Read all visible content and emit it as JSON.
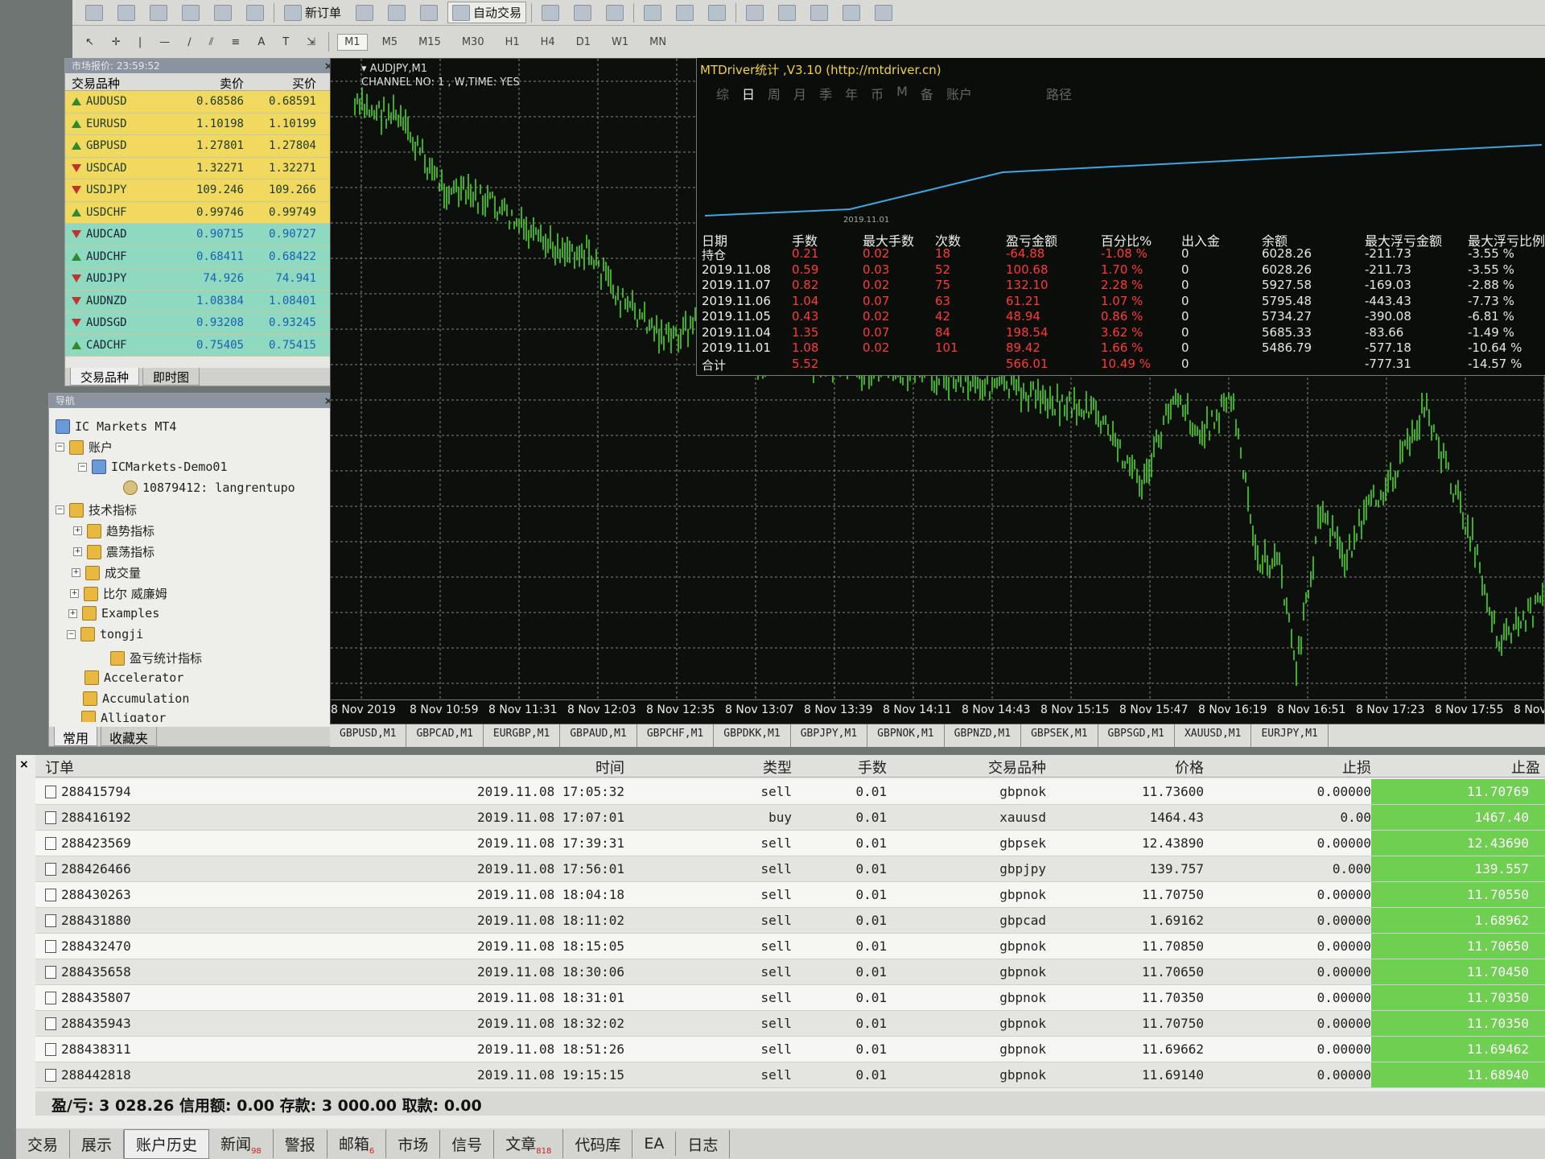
{
  "toolbar": {
    "new_order": "新订单",
    "auto_trading": "自动交易",
    "timeframes": [
      "M1",
      "M5",
      "M15",
      "M30",
      "H1",
      "H4",
      "D1",
      "W1",
      "MN"
    ]
  },
  "market_watch": {
    "title": "市场报价: 23:59:52",
    "col_symbol": "交易品种",
    "col_bid": "卖价",
    "col_ask": "买价",
    "rows": [
      {
        "symbol": "AUDUSD",
        "bid": "0.68586",
        "ask": "0.68591",
        "dir": "up"
      },
      {
        "symbol": "EURUSD",
        "bid": "1.10198",
        "ask": "1.10199",
        "dir": "up"
      },
      {
        "symbol": "GBPUSD",
        "bid": "1.27801",
        "ask": "1.27804",
        "dir": "up"
      },
      {
        "symbol": "USDCAD",
        "bid": "1.32271",
        "ask": "1.32271",
        "dir": "dn"
      },
      {
        "symbol": "USDJPY",
        "bid": "109.246",
        "ask": "109.266",
        "dir": "dn"
      },
      {
        "symbol": "USDCHF",
        "bid": "0.99746",
        "ask": "0.99749",
        "dir": "up"
      },
      {
        "symbol": "AUDCAD",
        "bid": "0.90715",
        "ask": "0.90727",
        "dir": "dn"
      },
      {
        "symbol": "AUDCHF",
        "bid": "0.68411",
        "ask": "0.68422",
        "dir": "up"
      },
      {
        "symbol": "AUDJPY",
        "bid": "74.926",
        "ask": "74.941",
        "dir": "dn"
      },
      {
        "symbol": "AUDNZD",
        "bid": "1.08384",
        "ask": "1.08401",
        "dir": "dn"
      },
      {
        "symbol": "AUDSGD",
        "bid": "0.93208",
        "ask": "0.93245",
        "dir": "dn"
      },
      {
        "symbol": "CADCHF",
        "bid": "0.75405",
        "ask": "0.75415",
        "dir": "up"
      }
    ],
    "tabs": [
      "交易品种",
      "即时图"
    ]
  },
  "navigator": {
    "title": "导航",
    "broker": "IC Markets MT4",
    "accounts": "账户",
    "demo": "ICMarkets-Demo01",
    "user": "10879412: langrentupo",
    "indicators": "技术指标",
    "trend": "趋势指标",
    "oscillators": "震荡指标",
    "volumes": "成交量",
    "bill_williams": "比尔 威廉姆",
    "examples": "Examples",
    "tongji": "tongji",
    "pnl_indicator": "盈亏统计指标",
    "accelerator": "Accelerator",
    "accumulation": "Accumulation",
    "alligator": "Alligator",
    "tabs": [
      "常用",
      "收藏夹"
    ]
  },
  "chart": {
    "symbol": "AUDJPY,M1",
    "channel": "CHANNEL NO: 1 , W,TIME: YES",
    "xlabels": [
      "8 Nov 2019",
      "8 Nov 10:59",
      "8 Nov 11:31",
      "8 Nov 12:03",
      "8 Nov 12:35",
      "8 Nov 13:07",
      "8 Nov 13:39",
      "8 Nov 14:11",
      "8 Nov 14:43",
      "8 Nov 15:15",
      "8 Nov 15:47",
      "8 Nov 16:19",
      "8 Nov 16:51",
      "8 Nov 17:23",
      "8 Nov 17:55",
      "8 Nov"
    ]
  },
  "stats": {
    "title": "MTDriver统计 ,V3.10 (http://mtdriver.cn)",
    "tabs": [
      "综",
      "日",
      "周",
      "月",
      "季",
      "年",
      "币",
      "M",
      "备",
      "账户",
      "",
      "路径"
    ],
    "equity_date": "2019.11.01",
    "headers": [
      "日期",
      "手数",
      "最大手数",
      "次数",
      "盈亏金额",
      "百分比%",
      "出入金",
      "余额",
      "最大浮亏金额",
      "最大浮亏比例"
    ],
    "rows": [
      [
        "持仓",
        "0.21",
        "0.02",
        "18",
        "-64.88",
        "-1.08 %",
        "0",
        "6028.26",
        "-211.73",
        "-3.55 %"
      ],
      [
        "2019.11.08",
        "0.59",
        "0.03",
        "52",
        "100.68",
        "1.70 %",
        "0",
        "6028.26",
        "-211.73",
        "-3.55 %"
      ],
      [
        "2019.11.07",
        "0.82",
        "0.02",
        "75",
        "132.10",
        "2.28 %",
        "0",
        "5927.58",
        "-169.03",
        "-2.88 %"
      ],
      [
        "2019.11.06",
        "1.04",
        "0.07",
        "63",
        "61.21",
        "1.07 %",
        "0",
        "5795.48",
        "-443.43",
        "-7.73 %"
      ],
      [
        "2019.11.05",
        "0.43",
        "0.02",
        "42",
        "48.94",
        "0.86 %",
        "0",
        "5734.27",
        "-390.08",
        "-6.81 %"
      ],
      [
        "2019.11.04",
        "1.35",
        "0.07",
        "84",
        "198.54",
        "3.62 %",
        "0",
        "5685.33",
        "-83.66",
        "-1.49 %"
      ],
      [
        "2019.11.01",
        "1.08",
        "0.02",
        "101",
        "89.42",
        "1.66 %",
        "0",
        "5486.79",
        "-577.18",
        "-10.64 %"
      ],
      [
        "合计",
        "5.52",
        "",
        "",
        "566.01",
        "10.49 %",
        "0",
        "",
        "-777.31",
        "-14.57 %"
      ]
    ]
  },
  "symbol_tabs": [
    "GBPUSD,M1",
    "GBPCAD,M1",
    "EURGBP,M1",
    "GBPAUD,M1",
    "GBPCHF,M1",
    "GBPDKK,M1",
    "GBPJPY,M1",
    "GBPNOK,M1",
    "GBPNZD,M1",
    "GBPSEK,M1",
    "GBPSGD,M1",
    "XAUUSD,M1",
    "EURJPY,M1"
  ],
  "terminal": {
    "headers": [
      "订单",
      "时间",
      "类型",
      "手数",
      "交易品种",
      "价格",
      "止损",
      "止盈"
    ],
    "rows": [
      [
        "288415794",
        "2019.11.08 17:05:32",
        "sell",
        "0.01",
        "gbpnok",
        "11.73600",
        "0.00000",
        "11.70769"
      ],
      [
        "288416192",
        "2019.11.08 17:07:01",
        "buy",
        "0.01",
        "xauusd",
        "1464.43",
        "0.00",
        "1467.40"
      ],
      [
        "288423569",
        "2019.11.08 17:39:31",
        "sell",
        "0.01",
        "gbpsek",
        "12.43890",
        "0.00000",
        "12.43690"
      ],
      [
        "288426466",
        "2019.11.08 17:56:01",
        "sell",
        "0.01",
        "gbpjpy",
        "139.757",
        "0.000",
        "139.557"
      ],
      [
        "288430263",
        "2019.11.08 18:04:18",
        "sell",
        "0.01",
        "gbpnok",
        "11.70750",
        "0.00000",
        "11.70550"
      ],
      [
        "288431880",
        "2019.11.08 18:11:02",
        "sell",
        "0.01",
        "gbpcad",
        "1.69162",
        "0.00000",
        "1.68962"
      ],
      [
        "288432470",
        "2019.11.08 18:15:05",
        "sell",
        "0.01",
        "gbpnok",
        "11.70850",
        "0.00000",
        "11.70650"
      ],
      [
        "288435658",
        "2019.11.08 18:30:06",
        "sell",
        "0.01",
        "gbpnok",
        "11.70650",
        "0.00000",
        "11.70450"
      ],
      [
        "288435807",
        "2019.11.08 18:31:01",
        "sell",
        "0.01",
        "gbpnok",
        "11.70350",
        "0.00000",
        "11.70350"
      ],
      [
        "288435943",
        "2019.11.08 18:32:02",
        "sell",
        "0.01",
        "gbpnok",
        "11.70750",
        "0.00000",
        "11.70350"
      ],
      [
        "288438311",
        "2019.11.08 18:51:26",
        "sell",
        "0.01",
        "gbpnok",
        "11.69662",
        "0.00000",
        "11.69462"
      ],
      [
        "288442818",
        "2019.11.08 19:15:15",
        "sell",
        "0.01",
        "gbpnok",
        "11.69140",
        "0.00000",
        "11.68940"
      ]
    ],
    "summary": "盈/亏: 3 028.26  信用额: 0.00  存款: 3 000.00  取款: 0.00",
    "tabs": [
      "交易",
      "展示",
      "账户历史",
      "新闻",
      "警报",
      "邮箱",
      "市场",
      "信号",
      "文章",
      "代码库",
      "EA",
      "日志"
    ],
    "news_badge": "98",
    "mail_badge": "6",
    "articles_badge": "818"
  }
}
